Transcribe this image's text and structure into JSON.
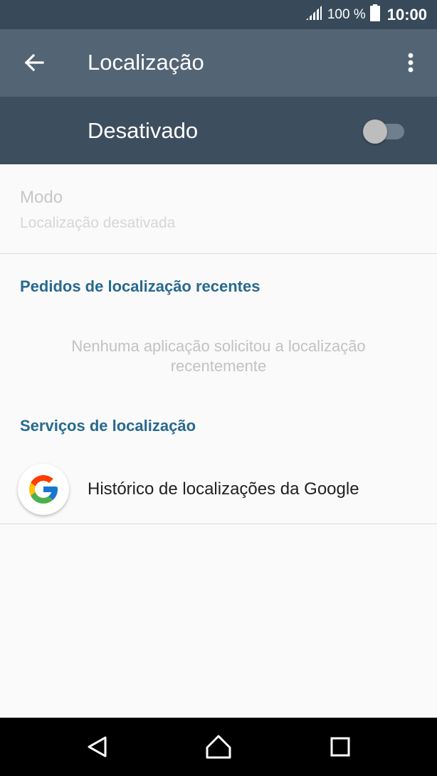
{
  "status_bar": {
    "battery_text": "100 %",
    "time": "10:00",
    "icons": [
      "signal-icon",
      "battery-icon"
    ]
  },
  "toolbar": {
    "title": "Localização",
    "icons": [
      "back-arrow-icon",
      "more-vert-icon"
    ]
  },
  "master_switch": {
    "label": "Desativado",
    "state": "off"
  },
  "mode": {
    "title": "Modo",
    "summary": "Localização desativada"
  },
  "recent_requests": {
    "header": "Pedidos de localização recentes",
    "empty_text": "Nenhuma aplicação solicitou a localização recentemente"
  },
  "location_services": {
    "header": "Serviços de localização",
    "items": [
      {
        "label": "Histórico de localizações da Google",
        "icon": "google-icon"
      }
    ]
  },
  "nav_bar": {
    "icons": [
      "back-triangle-icon",
      "home-icon",
      "recents-icon"
    ]
  },
  "colors": {
    "status_bar": "#384a5a",
    "toolbar": "#536475",
    "switch_bar": "#3d4e5f",
    "accent": "#27698f",
    "background": "#fafafa"
  }
}
